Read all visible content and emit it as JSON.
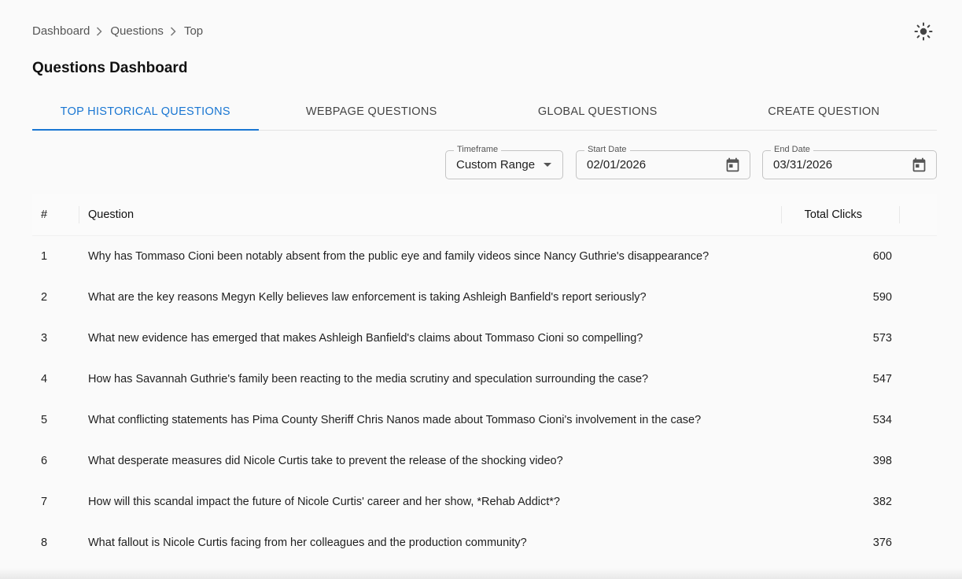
{
  "breadcrumb": {
    "items": [
      "Dashboard",
      "Questions"
    ],
    "current": "Top"
  },
  "header": {
    "title": "Questions Dashboard",
    "theme_toggle_icon": "sun-icon"
  },
  "tabs": [
    {
      "label": "TOP HISTORICAL QUESTIONS",
      "active": true
    },
    {
      "label": "WEBPAGE QUESTIONS",
      "active": false
    },
    {
      "label": "GLOBAL QUESTIONS",
      "active": false
    },
    {
      "label": "CREATE QUESTION",
      "active": false
    }
  ],
  "filters": {
    "timeframe": {
      "label": "Timeframe",
      "value": "Custom Range"
    },
    "start_date": {
      "label": "Start Date",
      "value": "02/01/2026"
    },
    "end_date": {
      "label": "End Date",
      "value": "03/31/2026"
    }
  },
  "table": {
    "columns": [
      "#",
      "Question",
      "Total Clicks"
    ],
    "rows": [
      {
        "num": "1",
        "question": "Why has Tommaso Cioni been notably absent from the public eye and family videos since Nancy Guthrie's disappearance?",
        "clicks": "600"
      },
      {
        "num": "2",
        "question": "What are the key reasons Megyn Kelly believes law enforcement is taking Ashleigh Banfield's report seriously?",
        "clicks": "590"
      },
      {
        "num": "3",
        "question": "What new evidence has emerged that makes Ashleigh Banfield's claims about Tommaso Cioni so compelling?",
        "clicks": "573"
      },
      {
        "num": "4",
        "question": "How has Savannah Guthrie's family been reacting to the media scrutiny and speculation surrounding the case?",
        "clicks": "547"
      },
      {
        "num": "5",
        "question": "What conflicting statements has Pima County Sheriff Chris Nanos made about Tommaso Cioni's involvement in the case?",
        "clicks": "534"
      },
      {
        "num": "6",
        "question": "What desperate measures did Nicole Curtis take to prevent the release of the shocking video?",
        "clicks": "398"
      },
      {
        "num": "7",
        "question": "How will this scandal impact the future of Nicole Curtis' career and her show, *Rehab Addict*?",
        "clicks": "382"
      },
      {
        "num": "8",
        "question": "What fallout is Nicole Curtis facing from her colleagues and the production community?",
        "clicks": "376"
      }
    ]
  },
  "colors": {
    "accent": "#1976d2",
    "background": "#fafafa"
  }
}
